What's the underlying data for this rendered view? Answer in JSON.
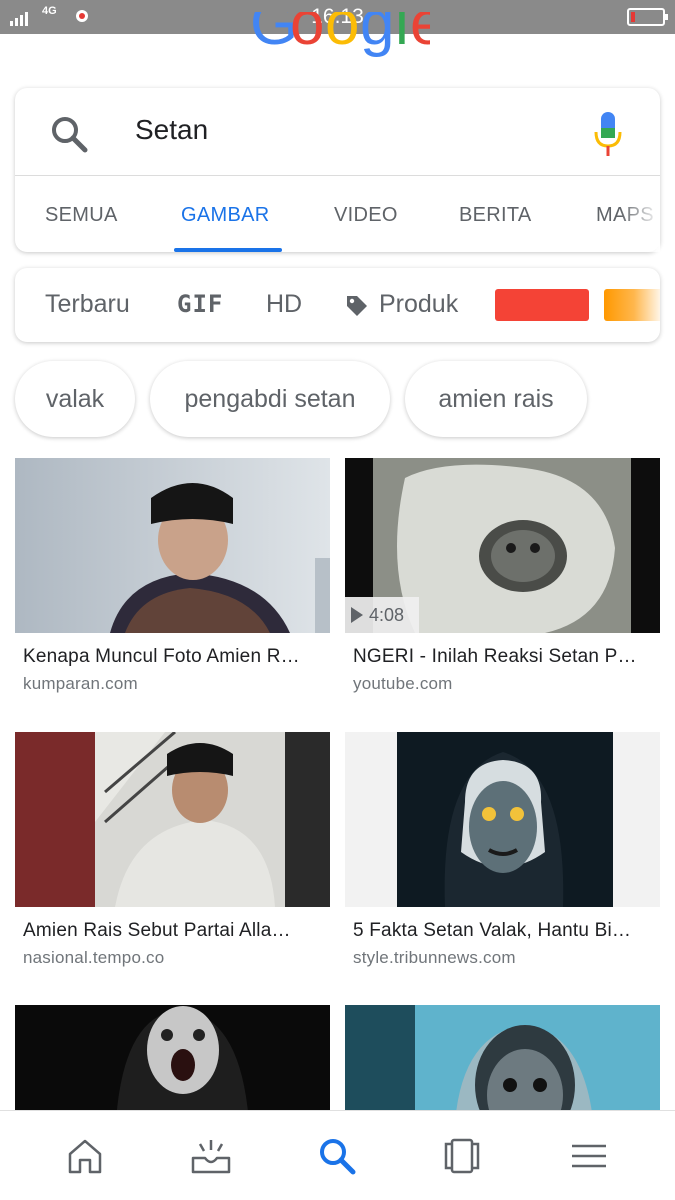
{
  "status_bar": {
    "time": "16.13",
    "network": "4G"
  },
  "logo": {
    "letters": [
      "G",
      "o",
      "o",
      "g",
      "l",
      "e"
    ],
    "colors": [
      "#4285f4",
      "#ea4335",
      "#fbbc05",
      "#4285f4",
      "#34a853",
      "#ea4335"
    ]
  },
  "search": {
    "query": "Setan"
  },
  "tabs": [
    {
      "label": "SEMUA"
    },
    {
      "label": "GAMBAR"
    },
    {
      "label": "VIDEO"
    },
    {
      "label": "BERITA"
    },
    {
      "label": "MAPS"
    }
  ],
  "active_tab": "GAMBAR",
  "filters": [
    {
      "label": "Terbaru"
    },
    {
      "label": "GIF"
    },
    {
      "label": "HD"
    },
    {
      "label": "Produk",
      "icon": "tag-icon"
    }
  ],
  "color_swatches": [
    "#f44336",
    "#ff9800"
  ],
  "chips": [
    {
      "label": "valak"
    },
    {
      "label": "pengabdi setan"
    },
    {
      "label": "amien rais"
    }
  ],
  "results": [
    {
      "title": "Kenapa Muncul Foto Amien R…",
      "source": "kumparan.com"
    },
    {
      "title": "NGERI - Inilah Reaksi Setan P…",
      "source": "youtube.com",
      "duration": "4:08"
    },
    {
      "title": "Amien Rais Sebut Partai Alla…",
      "source": "nasional.tempo.co"
    },
    {
      "title": "5 Fakta Setan Valak, Hantu Bi…",
      "source": "style.tribunnews.com"
    },
    {
      "title": "",
      "source": ""
    },
    {
      "title": "",
      "source": ""
    }
  ],
  "bottom_nav": [
    {
      "icon": "home-icon"
    },
    {
      "icon": "updates-icon"
    },
    {
      "icon": "search-icon",
      "active": true
    },
    {
      "icon": "tabs-icon"
    },
    {
      "icon": "menu-icon"
    }
  ],
  "colors": {
    "accent": "#1a73e8",
    "text": "#202124",
    "muted": "#5f6368"
  }
}
